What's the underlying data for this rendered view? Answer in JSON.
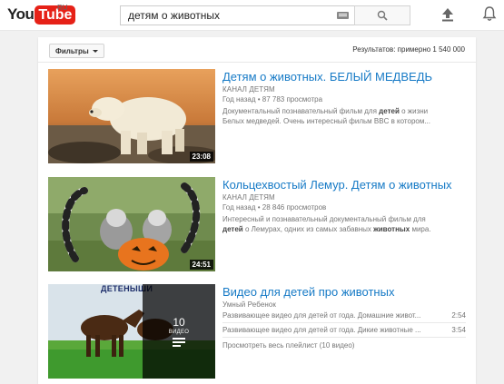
{
  "header": {
    "logo_you": "You",
    "logo_tube": "Tube",
    "logo_region": "RU",
    "search_value": "детям о животных",
    "icons": [
      "keyboard-icon",
      "search-icon",
      "upload-icon",
      "bell-icon"
    ]
  },
  "toolbar": {
    "filters_label": "Фильтры",
    "results_label": "Результатов: примерно 1 540 000"
  },
  "results": [
    {
      "title": "Детям о животных. БЕЛЫЙ МЕДВЕДЬ",
      "channel": "КАНАЛ ДЕТЯМ",
      "meta": "Год назад • 87 783 просмотра",
      "desc_1_pre": "Документальный познавательный фильм для ",
      "desc_1_bold": "детей",
      "desc_1_post": " о жизни",
      "desc_2": "Белых медведей. Очень интересный фильм BBC в котором...",
      "duration": "23:08"
    },
    {
      "title": "Кольцехвостый Лемур. Детям о животных",
      "channel": "КАНАЛ ДЕТЯМ",
      "meta": "Год назад • 28 846 просмотров",
      "desc_1": "Интересный и познавательный документальный фильм для",
      "desc_2_bold1": "детей",
      "desc_2_mid": " о Лемурах, одних из самых забавных ",
      "desc_2_bold2": "животных",
      "desc_2_post": " мира.",
      "duration": "24:51"
    },
    {
      "title": "Видео для детей про животных",
      "channel": "Умный Ребенок",
      "banner": "ДЕТЕНЫШИ",
      "playlist_count": "10",
      "playlist_label": "ВИДЕО",
      "playlist_items": [
        {
          "title": "Развивающее видео для детей от года. Домашние живот...",
          "time": "2:54"
        },
        {
          "title": "Развивающее видео для детей от года. Дикие животные ...",
          "time": "3:54"
        }
      ],
      "view_all": "Просмотреть весь плейлист (10 видео)"
    }
  ]
}
